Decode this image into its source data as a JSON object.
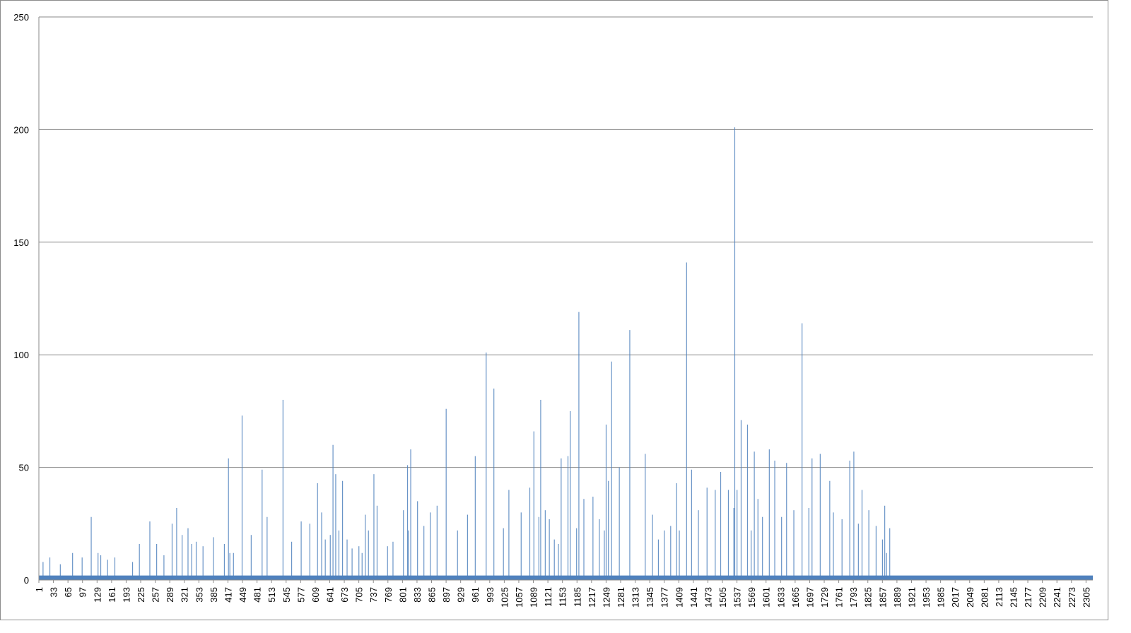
{
  "chart_data": {
    "type": "bar",
    "title": "",
    "xlabel": "",
    "ylabel": "",
    "ylim": [
      0,
      250
    ],
    "y_ticks": [
      "0",
      "50",
      "100",
      "150",
      "200",
      "250"
    ],
    "x_range": [
      1,
      2320
    ],
    "x_tick_labels": [
      "1",
      "33",
      "65",
      "97",
      "129",
      "161",
      "193",
      "225",
      "257",
      "289",
      "321",
      "353",
      "385",
      "417",
      "449",
      "481",
      "513",
      "545",
      "577",
      "609",
      "641",
      "673",
      "705",
      "737",
      "769",
      "801",
      "833",
      "865",
      "897",
      "929",
      "961",
      "993",
      "1025",
      "1057",
      "1089",
      "1121",
      "1153",
      "1185",
      "1217",
      "1249",
      "1281",
      "1313",
      "1345",
      "1377",
      "1409",
      "1441",
      "1473",
      "1505",
      "1537",
      "1569",
      "1601",
      "1633",
      "1665",
      "1697",
      "1729",
      "1761",
      "1793",
      "1825",
      "1857",
      "1889",
      "1921",
      "1953",
      "1985",
      "2017",
      "2049",
      "2081",
      "2113",
      "2145",
      "2177",
      "2209",
      "2241",
      "2273",
      "2305"
    ],
    "grid": "horizontal",
    "legend": "none",
    "bar_color": "#4f81bd",
    "x": [
      10,
      25,
      48,
      75,
      96,
      116,
      131,
      137,
      152,
      168,
      207,
      222,
      245,
      260,
      276,
      294,
      304,
      316,
      329,
      337,
      347,
      362,
      385,
      409,
      418,
      421,
      429,
      448,
      468,
      492,
      503,
      538,
      557,
      578,
      597,
      614,
      623,
      631,
      642,
      648,
      654,
      661,
      669,
      679,
      690,
      705,
      712,
      719,
      726,
      738,
      745,
      768,
      780,
      803,
      812,
      814,
      819,
      834,
      848,
      862,
      877,
      897,
      922,
      944,
      961,
      985,
      1002,
      1023,
      1035,
      1062,
      1081,
      1090,
      1101,
      1105,
      1115,
      1124,
      1135,
      1144,
      1150,
      1165,
      1170,
      1184,
      1189,
      1200,
      1220,
      1234,
      1245,
      1249,
      1254,
      1261,
      1278,
      1301,
      1335,
      1351,
      1364,
      1377,
      1391,
      1404,
      1410,
      1426,
      1437,
      1452,
      1471,
      1489,
      1501,
      1518,
      1530,
      1532,
      1537,
      1546,
      1560,
      1568,
      1575,
      1583,
      1593,
      1608,
      1620,
      1635,
      1646,
      1662,
      1680,
      1695,
      1702,
      1720,
      1741,
      1749,
      1768,
      1785,
      1794,
      1804,
      1812,
      1827,
      1843,
      1857,
      1862,
      1866,
      1873,
      1885,
      1891,
      1895,
      1901,
      1910,
      1917,
      1950,
      1964,
      1972,
      1986,
      1991,
      2004,
      2017,
      2024,
      2036,
      2047,
      2057,
      2069,
      2075,
      2082,
      2087,
      2098,
      2104,
      2113,
      2124,
      2134,
      2147,
      2153,
      2164,
      2170,
      2181,
      2189,
      2204,
      2215,
      2230,
      2240,
      2249,
      2255,
      2269,
      2283,
      2296,
      2301
    ],
    "values": [
      8,
      10,
      7,
      12,
      10,
      28,
      12,
      11,
      9,
      10,
      8,
      16,
      26,
      16,
      11,
      25,
      32,
      20,
      23,
      16,
      17,
      15,
      19,
      16,
      54,
      12,
      12,
      73,
      20,
      49,
      28,
      80,
      17,
      26,
      25,
      43,
      30,
      18,
      20,
      60,
      47,
      22,
      44,
      18,
      14,
      15,
      12,
      29,
      22,
      47,
      33,
      15,
      17,
      31,
      51,
      22,
      58,
      35,
      24,
      30,
      33,
      76,
      22,
      29,
      55,
      101,
      85,
      23,
      40,
      30,
      41,
      66,
      28,
      80,
      31,
      27,
      18,
      16,
      54,
      55,
      75,
      23,
      119,
      36,
      37,
      27,
      22,
      69,
      44,
      97,
      50,
      111,
      56,
      29,
      18,
      22,
      24,
      43,
      22,
      141,
      49,
      31,
      41,
      40,
      48,
      40,
      32,
      201,
      40,
      71,
      69,
      22,
      57,
      36,
      28,
      58,
      53,
      28,
      52,
      31,
      114,
      32,
      54,
      56,
      44,
      30,
      27,
      53,
      57,
      25,
      40,
      31,
      24,
      18,
      33,
      12,
      23
    ],
    "baseline_band": 2
  }
}
